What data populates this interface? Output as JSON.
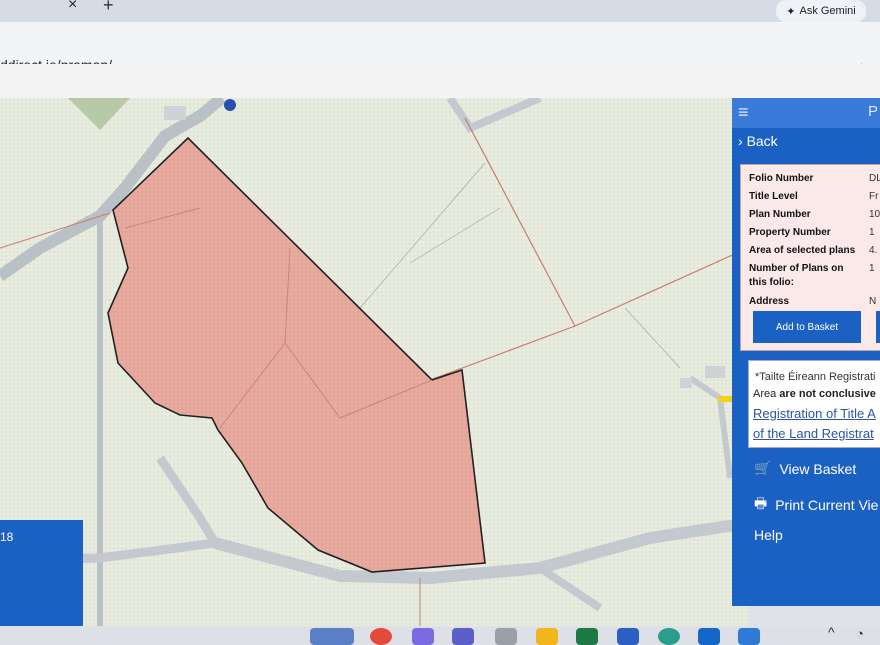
{
  "browser": {
    "gemini_label": "Ask Gemini",
    "url": "ddirect.ie/pramap/"
  },
  "panel": {
    "header_letter": "P",
    "back_label": "Back",
    "info_rows": [
      {
        "label": "Folio Number",
        "value": "DL"
      },
      {
        "label": "Title Level",
        "value": "Fr"
      },
      {
        "label": "Plan Number",
        "value": "10"
      },
      {
        "label": "Property Number",
        "value": "1"
      },
      {
        "label": "Area of selected plans",
        "value": "4."
      },
      {
        "label": "Number of Plans on",
        "value": "1"
      },
      {
        "label": "this folio:",
        "value": ""
      },
      {
        "label": "Address",
        "value": "N"
      }
    ],
    "add_to_basket": "Add to Basket",
    "note": {
      "line1": "*Tailte Éireann Registrati",
      "line2_prefix": "Area ",
      "line2_bold": "are not conclusive",
      "link1": "Registration of Title A",
      "link2": "of the Land Registrat"
    },
    "menu": {
      "view_basket": "View Basket",
      "print_view": "Print Current Vie",
      "help": "Help"
    }
  },
  "left_box": {
    "label": "18"
  },
  "colors": {
    "panel_blue": "#1b61c4",
    "parcel_fill": "#e8a99e",
    "parcel_stroke": "#222222"
  }
}
